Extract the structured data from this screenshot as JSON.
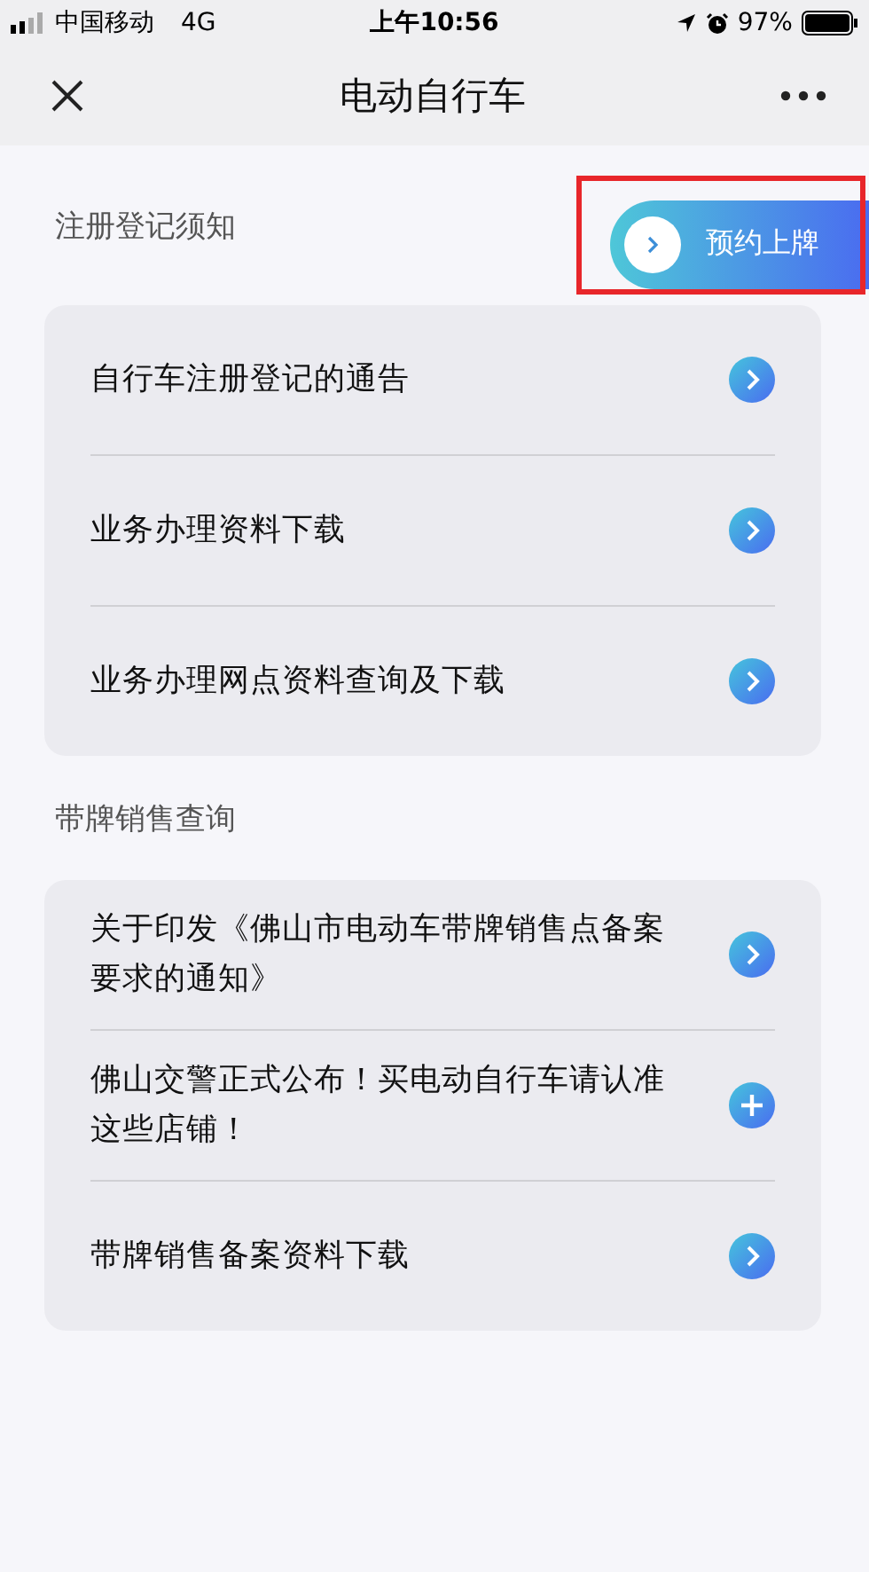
{
  "status_bar": {
    "carrier": "中国移动",
    "network": "4G",
    "time": "上午10:56",
    "battery": "97%"
  },
  "nav": {
    "title": "电动自行车"
  },
  "sections": [
    {
      "title": "注册登记须知",
      "action": {
        "label": "预约上牌",
        "highlighted": true
      },
      "items": [
        {
          "text": "自行车注册登记的通告",
          "kind": "arrow"
        },
        {
          "text": "业务办理资料下载",
          "kind": "arrow"
        },
        {
          "text": "业务办理网点资料查询及下载",
          "kind": "arrow"
        }
      ]
    },
    {
      "title": "带牌销售查询",
      "items": [
        {
          "text": "关于印发《佛山市电动车带牌销售点备案要求的通知》",
          "kind": "arrow"
        },
        {
          "text": "佛山交警正式公布！买电动自行车请认准这些店铺！",
          "kind": "plus"
        },
        {
          "text": "带牌销售备案资料下载",
          "kind": "arrow"
        }
      ]
    }
  ]
}
